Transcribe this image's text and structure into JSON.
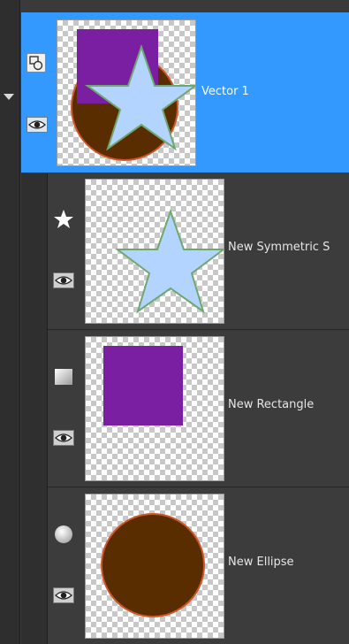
{
  "layers": {
    "group": {
      "label": "Vector 1",
      "colors": {
        "selected_bg": "#3399ff",
        "rectangle_fill": "#7a1fa2",
        "ellipse_fill": "#5a2d00",
        "ellipse_stroke": "#d0562a",
        "star_fill": "#b3d4ff",
        "star_stroke": "#6fa86f"
      }
    },
    "children": [
      {
        "label": "New Symmetric S",
        "icon": "star-shape-icon"
      },
      {
        "label": "New Rectangle",
        "icon": "rectangle-shape-icon"
      },
      {
        "label": "New Ellipse",
        "icon": "ellipse-shape-icon"
      }
    ]
  }
}
